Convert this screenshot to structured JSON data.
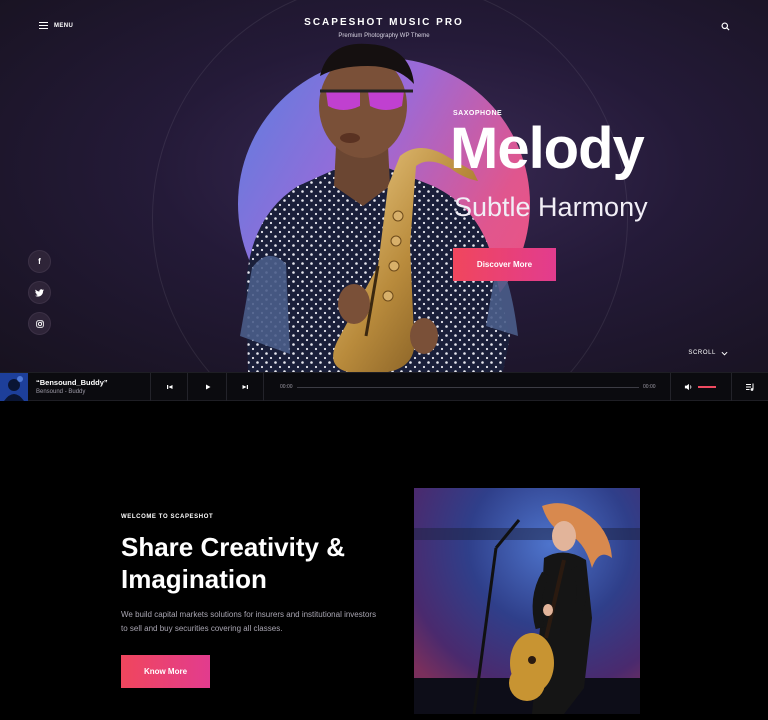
{
  "header": {
    "menu_label": "MENU",
    "site_title": "SCAPESHOT MUSIC PRO",
    "site_tagline": "Premium Photography WP Theme",
    "search_icon": "search-icon"
  },
  "hero": {
    "kicker": "SAXOPHONE",
    "title": "Melody",
    "subtitle": "Subtle Harmony",
    "cta_label": "Discover More",
    "scroll_label": "SCROLL",
    "colors": {
      "accent_start": "#f0465d",
      "accent_end": "#e23c8e",
      "disc_blue": "#5b7fe0",
      "disc_pink": "#f0527f"
    }
  },
  "social": [
    {
      "icon": "facebook-icon",
      "glyph": "f"
    },
    {
      "icon": "twitter-icon",
      "glyph": "t"
    },
    {
      "icon": "instagram-icon",
      "glyph": "◎"
    }
  ],
  "player": {
    "track_title": "“Bensound_Buddy”",
    "track_artist": "Bensound - Buddy",
    "time_current": "00:00",
    "time_total": "00:00",
    "progress": 0,
    "volume": 1
  },
  "welcome": {
    "kicker": "WELCOME TO SCAPESHOT",
    "title": "Share Creativity & Imagination",
    "description": "We build capital markets solutions for insurers and institutional investors to sell and buy securities covering all classes.",
    "cta_label": "Know More"
  }
}
